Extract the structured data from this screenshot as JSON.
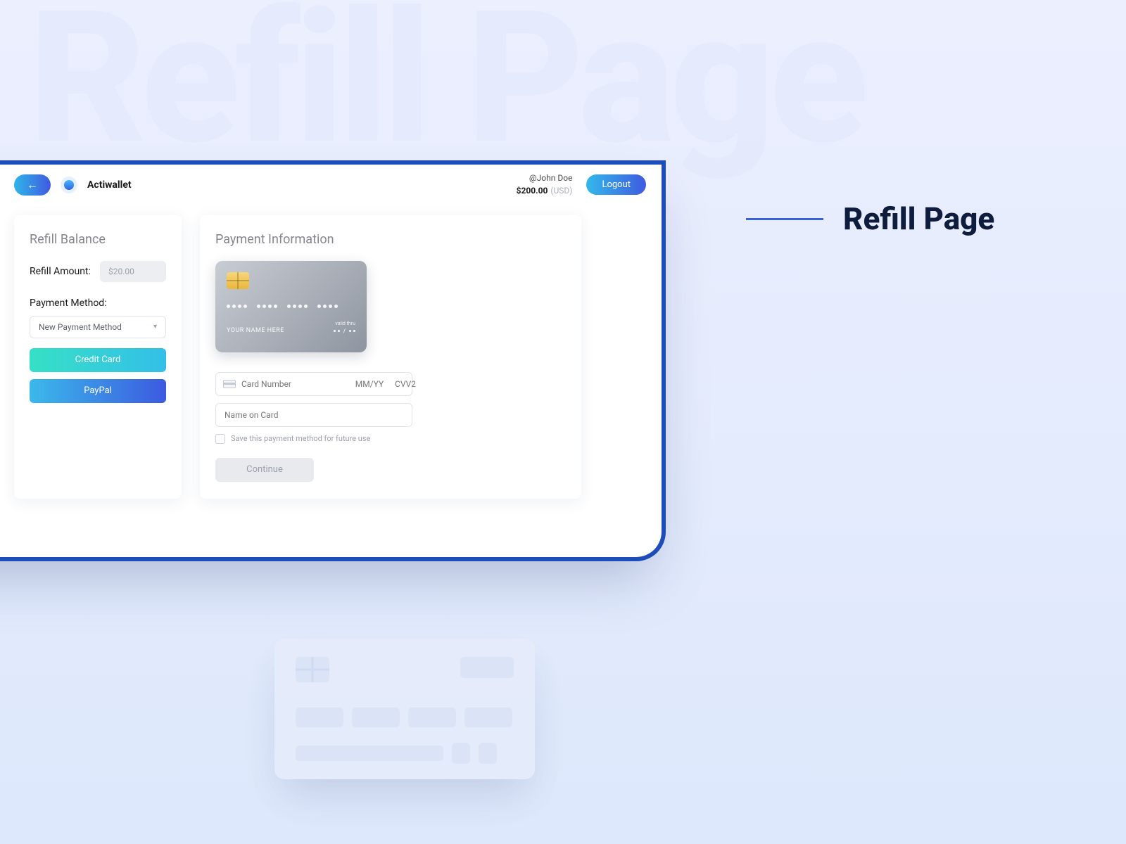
{
  "background_text": "Refill Page",
  "page_title": "Refill Page",
  "topbar": {
    "brand": "Actiwallet",
    "user_handle": "@John Doe",
    "balance": "$200.00",
    "currency": "(USD)",
    "logout_label": "Logout"
  },
  "left_card": {
    "title": "Refill Balance",
    "amount_label": "Refill Amount:",
    "amount_value": "$20.00",
    "method_label": "Payment Method:",
    "dropdown_value": "New Payment Method",
    "option_credit": "Credit Card",
    "option_paypal": "PayPal"
  },
  "right_card": {
    "title": "Payment Information",
    "preview_name": "YOUR NAME HERE",
    "valid_thru_label": "valid thru",
    "card_number_placeholder": "Card Number",
    "expiry_placeholder": "MM/YY",
    "cvv_placeholder": "CVV2",
    "name_placeholder": "Name on Card",
    "save_label": "Save this payment method for future use",
    "continue_label": "Continue"
  }
}
